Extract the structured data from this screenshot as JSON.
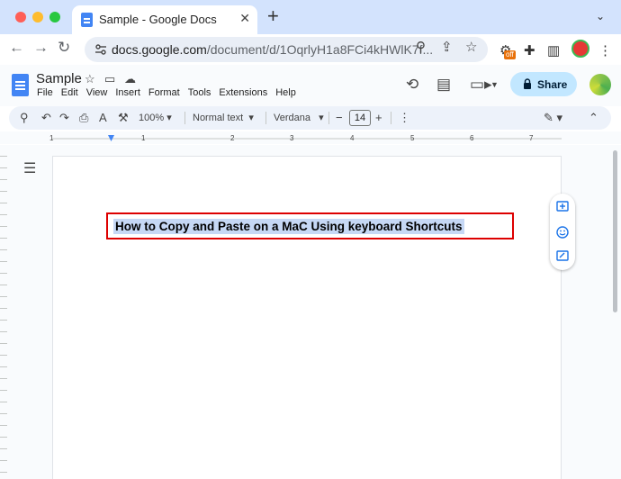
{
  "browser": {
    "tab_title": "Sample - Google Docs",
    "url_host": "docs.google.com",
    "url_path": "/document/d/1OqrlyH1a8FCi4kHWlK7f...",
    "extension_badge": "off"
  },
  "doc": {
    "title": "Sample",
    "menu": [
      "File",
      "Edit",
      "View",
      "Insert",
      "Format",
      "Tools",
      "Extensions",
      "Help"
    ],
    "share_label": "Share"
  },
  "toolbar": {
    "zoom": "100%",
    "style": "Normal text",
    "font": "Verdana",
    "font_size": "14"
  },
  "ruler": {
    "numbers": [
      "1",
      "1",
      "2",
      "3",
      "4",
      "5",
      "6",
      "7"
    ]
  },
  "content": {
    "heading": "How to Copy and Paste on a MaC Using keyboard Shortcuts"
  },
  "colors": {
    "tabstrip": "#d3e3fd",
    "share_button": "#c2e7ff",
    "highlight_box": "#dd0000",
    "selection": "#c6d8f5"
  }
}
